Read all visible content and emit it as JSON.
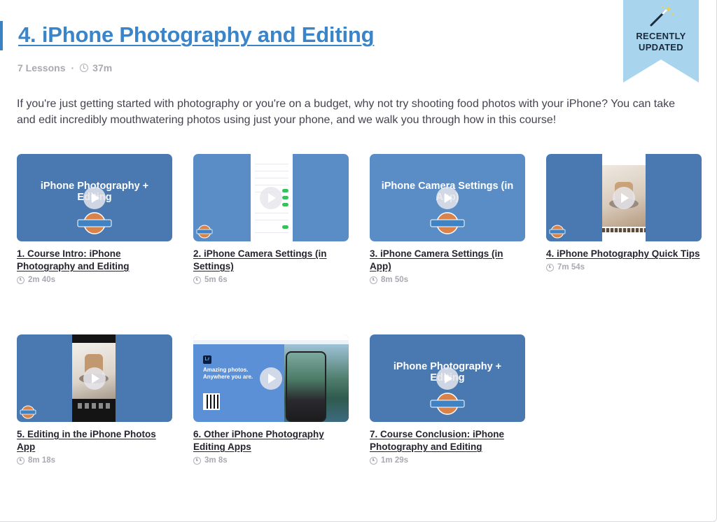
{
  "course": {
    "title": "4. iPhone Photography and Editing",
    "lessons_count": "7 Lessons",
    "separator": "·",
    "duration": "37m",
    "description": "If you're just getting started with photography or you're on a budget, why not try shooting food photos with your iPhone? You can take and edit incredibly mouthwatering photos using just your phone, and we walk you through how in this course!",
    "badge": "RECENTLY\nUPDATED",
    "badge_line1": "RECENTLY",
    "badge_line2": "UPDATED"
  },
  "logo_text": {
    "line1": "FOOD",
    "line2": "Blogger",
    "line3": "PRO"
  },
  "lessons": [
    {
      "title": "1. Course Intro: iPhone Photography and Editing",
      "duration": "2m 40s",
      "thumb_text": "iPhone Photography + Editing"
    },
    {
      "title": "2. iPhone Camera Settings (in Settings)",
      "duration": "5m 6s"
    },
    {
      "title": "3. iPhone Camera Settings (in App)",
      "duration": "8m 50s",
      "thumb_text": "iPhone Camera Settings (in App)"
    },
    {
      "title": "4. iPhone Photography Quick Tips",
      "duration": "7m 54s"
    },
    {
      "title": "5. Editing in the iPhone Photos App",
      "duration": "8m 18s"
    },
    {
      "title": "6. Other iPhone Photography Editing Apps",
      "duration": "3m 8s",
      "thumb_text": "Amazing photos. Anywhere you are."
    },
    {
      "title": "7. Course Conclusion: iPhone Photography and Editing",
      "duration": "1m 29s",
      "thumb_text": "iPhone Photography + Editing"
    }
  ],
  "colors": {
    "accent": "#3a85c9",
    "thumb_blue": "#4a78b0",
    "ribbon": "#a8d4ee",
    "logo_orange": "#d9824a"
  }
}
